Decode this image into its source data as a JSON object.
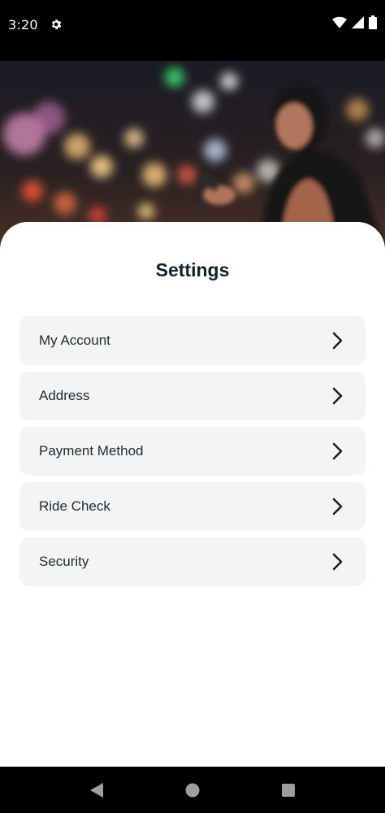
{
  "status_bar": {
    "time": "3:20",
    "icons": [
      "gear-icon",
      "wifi-icon",
      "signal-icon",
      "battery-icon"
    ]
  },
  "hero": {
    "image": "woman-with-phone-city-night-photo"
  },
  "settings": {
    "title": "Settings",
    "items": [
      {
        "label": "My Account",
        "icon": "chevron-right-icon"
      },
      {
        "label": "Address",
        "icon": "chevron-right-icon"
      },
      {
        "label": "Payment Method",
        "icon": "chevron-right-icon"
      },
      {
        "label": "Ride Check",
        "icon": "chevron-right-icon"
      },
      {
        "label": "Security",
        "icon": "chevron-right-icon"
      }
    ]
  },
  "nav_bar": {
    "buttons": [
      "back-icon",
      "home-icon",
      "recents-icon"
    ]
  },
  "colors": {
    "sheet_background": "#ffffff",
    "item_background": "#f4f4f4",
    "title_text": "#13222b",
    "item_text": "#1f2a30"
  }
}
